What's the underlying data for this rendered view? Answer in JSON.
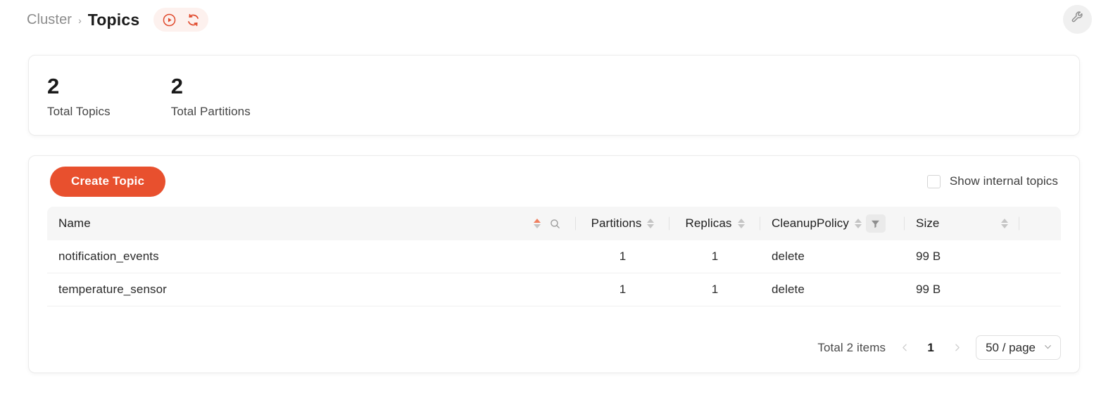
{
  "header": {
    "breadcrumb_root": "Cluster",
    "breadcrumb_separator": "›",
    "breadcrumb_current": "Topics",
    "play_icon": "play-circle-icon",
    "refresh_icon": "refresh-icon",
    "tools_icon": "wrench-icon",
    "accent_color": "#e8502e",
    "pill_background": "#fdf1ee"
  },
  "stats": [
    {
      "value": "2",
      "label": "Total Topics"
    },
    {
      "value": "2",
      "label": "Total Partitions"
    }
  ],
  "toolbar": {
    "create_label": "Create Topic",
    "internal_label": "Show internal topics",
    "internal_checked": false
  },
  "table": {
    "columns": [
      {
        "label": "Name",
        "sortable": true,
        "sort_state": "asc",
        "has_search": true
      },
      {
        "label": "Partitions",
        "sortable": true,
        "sort_state": "none"
      },
      {
        "label": "Replicas",
        "sortable": true,
        "sort_state": "none"
      },
      {
        "label": "CleanupPolicy",
        "sortable": true,
        "sort_state": "none",
        "has_filter": true
      },
      {
        "label": "Size",
        "sortable": true,
        "sort_state": "none"
      }
    ],
    "rows": [
      {
        "name": "notification_events",
        "partitions": "1",
        "replicas": "1",
        "cleanup_policy": "delete",
        "size": "99 B"
      },
      {
        "name": "temperature_sensor",
        "partitions": "1",
        "replicas": "1",
        "cleanup_policy": "delete",
        "size": "99 B"
      }
    ]
  },
  "pagination": {
    "total_text": "Total 2 items",
    "prev_icon": "chevron-left-icon",
    "next_icon": "chevron-right-icon",
    "current_page": "1",
    "page_size_label": "50 / page",
    "page_size_caret": "chevron-down-icon"
  }
}
